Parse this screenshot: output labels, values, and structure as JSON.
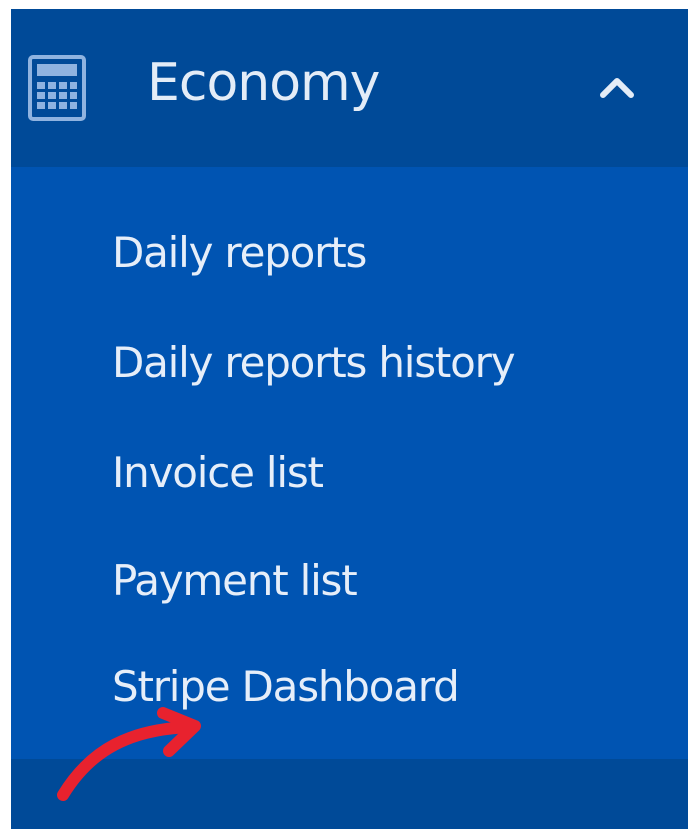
{
  "menu": {
    "section": {
      "label": "Economy",
      "icon": "calculator-icon",
      "toggle_icon": "chevron-up-icon",
      "expanded": true
    },
    "items": [
      {
        "label": "Daily reports"
      },
      {
        "label": "Daily reports history"
      },
      {
        "label": "Invoice list"
      },
      {
        "label": "Payment list"
      },
      {
        "label": "Stripe Dashboard"
      }
    ]
  },
  "annotation": {
    "icon": "curved-arrow-icon",
    "color": "#e8222e"
  },
  "colors": {
    "header_bg": "#004a98",
    "submenu_bg": "#0054b2",
    "text": "#e6eef9"
  }
}
